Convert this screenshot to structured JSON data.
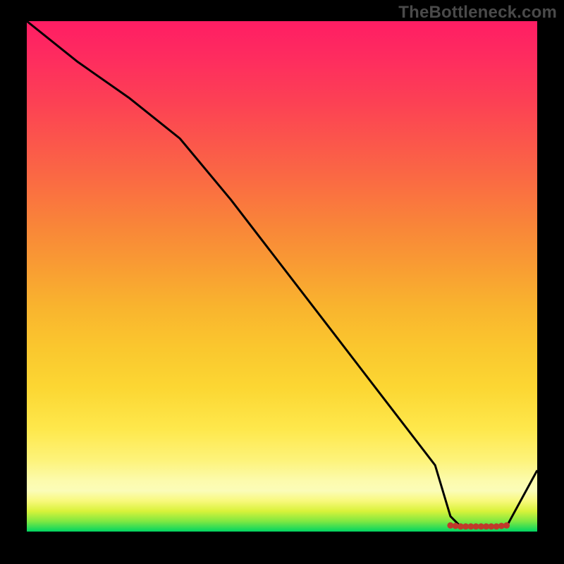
{
  "watermark": "TheBottleneck.com",
  "colors": {
    "background": "#000000",
    "line": "#000000",
    "markers": "#c0392b"
  },
  "chart_data": {
    "type": "line",
    "title": "",
    "xlabel": "",
    "ylabel": "",
    "xlim": [
      0,
      100
    ],
    "ylim": [
      0,
      100
    ],
    "x": [
      0,
      10,
      20,
      30,
      40,
      50,
      60,
      70,
      80,
      83,
      85,
      88,
      90,
      92,
      94,
      100
    ],
    "values": [
      100,
      92,
      85,
      77,
      65,
      52,
      39,
      26,
      13,
      3,
      1,
      1,
      1,
      1,
      1,
      12
    ],
    "markers": {
      "x": [
        83,
        84,
        85,
        86,
        87,
        88,
        89,
        90,
        91,
        92,
        93,
        94
      ],
      "values": [
        1.2,
        1.1,
        1.0,
        1.0,
        1.0,
        1.0,
        1.0,
        1.0,
        1.0,
        1.0,
        1.1,
        1.2
      ]
    }
  }
}
